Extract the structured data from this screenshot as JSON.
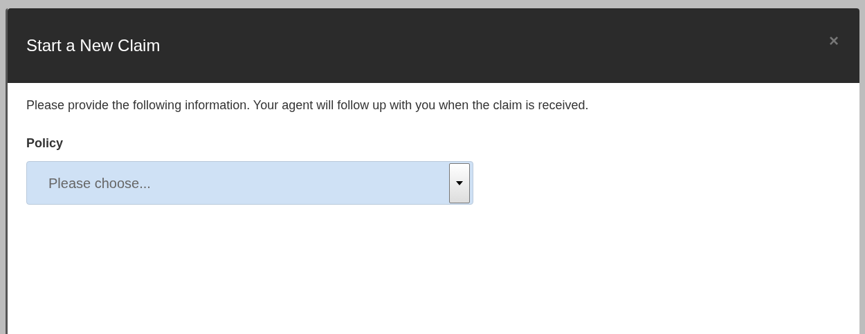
{
  "dialog": {
    "title": "Start a New Claim",
    "close": "×",
    "message": "Please provide the following information. Your agent will follow up with you when the claim is received.",
    "fields": [
      {
        "label": "Policy",
        "kind": "select",
        "value": "Please choose..."
      }
    ]
  }
}
